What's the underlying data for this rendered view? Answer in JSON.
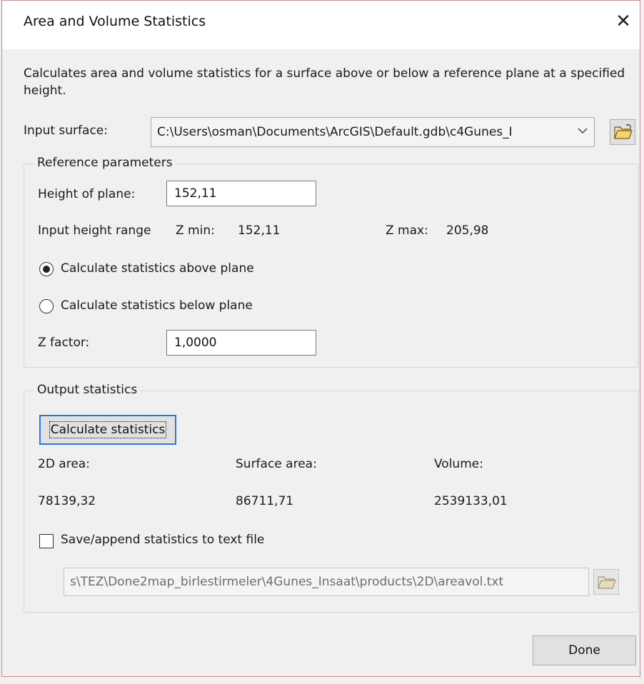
{
  "window": {
    "title": "Area and Volume Statistics",
    "close_glyph": "✕"
  },
  "description": "Calculates area and volume statistics for a surface above or below a reference plane at a specified height.",
  "input_surface": {
    "label": "Input surface:",
    "value": "C:\\Users\\osman\\Documents\\ArcGIS\\Default.gdb\\c4Gunes_I",
    "browse_icon": "folder-open-icon"
  },
  "reference": {
    "group_title": "Reference parameters",
    "height_label": "Height of plane:",
    "height_value": "152,11",
    "range_label": "Input height range",
    "zmin_label": "Z min:",
    "zmin_value": "152,11",
    "zmax_label": "Z max:",
    "zmax_value": "205,98",
    "above_label": "Calculate statistics above plane",
    "above_checked": true,
    "below_label": "Calculate statistics below plane",
    "below_checked": false,
    "zfactor_label": "Z factor:",
    "zfactor_value": "1,0000"
  },
  "output": {
    "group_title": "Output statistics",
    "calc_button": "Calculate statistics",
    "area2d_label": "2D area:",
    "area2d_value": "78139,32",
    "surface_label": "Surface area:",
    "surface_value": "86711,71",
    "volume_label": "Volume:",
    "volume_value": "2539133,01",
    "save_label": "Save/append statistics to text file",
    "save_checked": false,
    "file_path": "s\\TEZ\\Done2map_birlestirmeler\\4Gunes_Insaat\\products\\2D\\areavol.txt"
  },
  "footer": {
    "done_button": "Done"
  },
  "colors": {
    "dialog_bg": "#f0f0f0",
    "titlebar_bg": "#ffffff",
    "focus_border": "#2a7ad5",
    "disabled_text": "#6d6d6d"
  }
}
